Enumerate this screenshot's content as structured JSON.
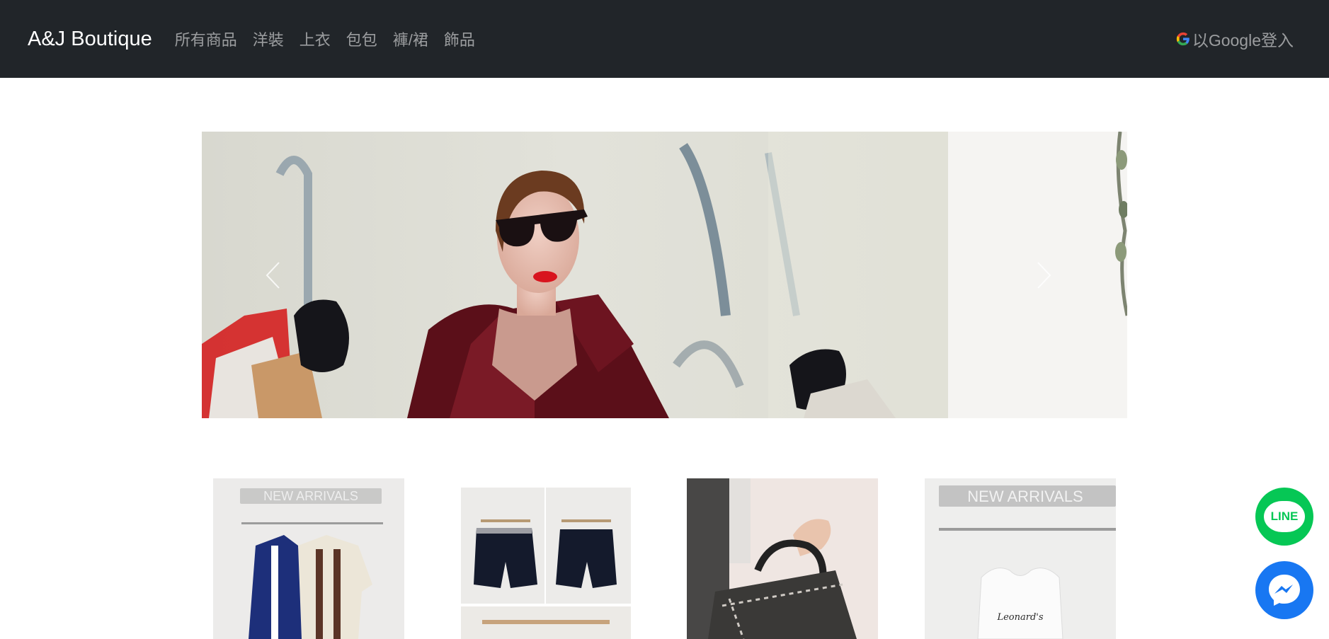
{
  "navbar": {
    "brand": "A&J Boutique",
    "links": [
      "所有商品",
      "洋裝",
      "上衣",
      "包包",
      "褲/裙",
      "飾品"
    ],
    "login_label": "以Google登入",
    "bg_color": "#212529"
  },
  "carousel": {
    "prev_icon": "chevron-left-icon",
    "next_icon": "chevron-right-icon"
  },
  "products": [
    {
      "name": "product-card-1",
      "sign_text": "NEW ARRIVALS"
    },
    {
      "name": "product-card-2"
    },
    {
      "name": "product-card-3"
    },
    {
      "name": "product-card-4",
      "sign_text": "NEW ARRIVALS",
      "shirt_text": "Leonard's"
    }
  ],
  "floating": {
    "line_label": "LINE",
    "messenger_icon": "messenger-icon",
    "line_color": "#06c755",
    "messenger_color": "#1877f2"
  }
}
